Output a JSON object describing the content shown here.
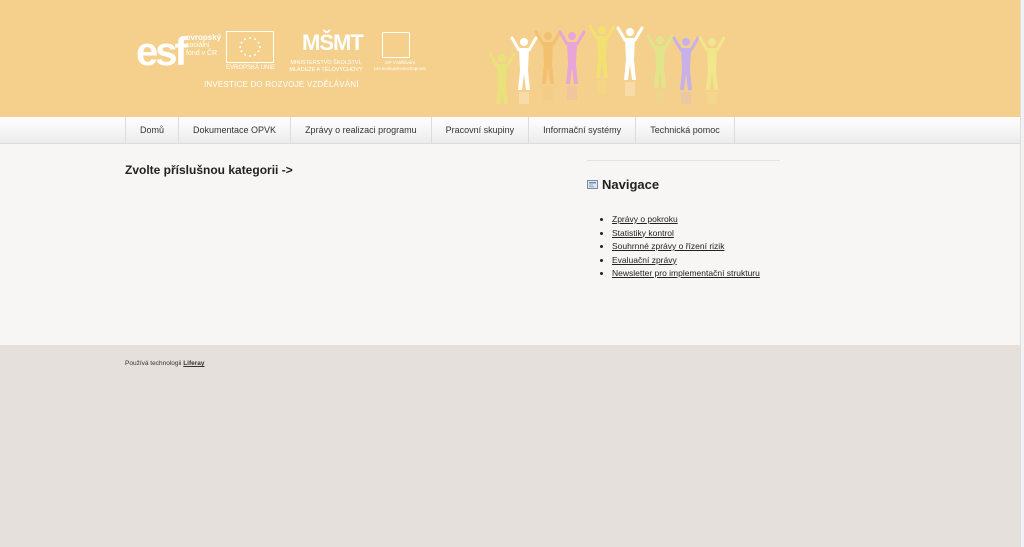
{
  "header": {
    "esf_mark": "esf",
    "esf_text_1": "evropský",
    "esf_text_2": "sociální",
    "esf_text_3": "fond v ČR",
    "eu_label": "EVROPSKÁ UNIE",
    "msmt_mark": "MŠMT",
    "msmt_label": "MINISTERSTVO ŠKOLSTVÍ, MLÁDEŽE A TĚLOVÝCHOVY",
    "op_label_1": "OP Vzdělávání",
    "op_label_2": "pro konkurenceschopnost",
    "tagline": "INVESTICE DO ROZVOJE VZDĚLÁVÁNÍ",
    "figure_colors": [
      "#e9e27a",
      "#ffffff",
      "#f3c070",
      "#e8a6d8",
      "#f2e070",
      "#ffffff",
      "#e0e48a",
      "#c8b0e8",
      "#f0e68a"
    ]
  },
  "navbar": {
    "items": [
      {
        "label": "Domů"
      },
      {
        "label": "Dokumentace OPVK"
      },
      {
        "label": "Zprávy o realizaci programu"
      },
      {
        "label": "Pracovní skupiny"
      },
      {
        "label": "Informační systémy"
      },
      {
        "label": "Technická pomoc"
      }
    ]
  },
  "main": {
    "heading": "Zvolte příslušnou kategorii ->"
  },
  "sidebar": {
    "title": "Navigace",
    "links": [
      {
        "label": "Zprávy o pokroku"
      },
      {
        "label": "Statistiky kontrol"
      },
      {
        "label": "Souhrnné zprávy o řízení rizik"
      },
      {
        "label": "Evaluační zprávy"
      },
      {
        "label": "Newsletter pro implementační strukturu"
      }
    ]
  },
  "footer": {
    "prefix": "Používá technologii",
    "link": "Liferay"
  },
  "colors": {
    "header_bg": "#f4d08c",
    "content_bg": "#f7f6f5",
    "page_bg": "#e6e0dc"
  }
}
